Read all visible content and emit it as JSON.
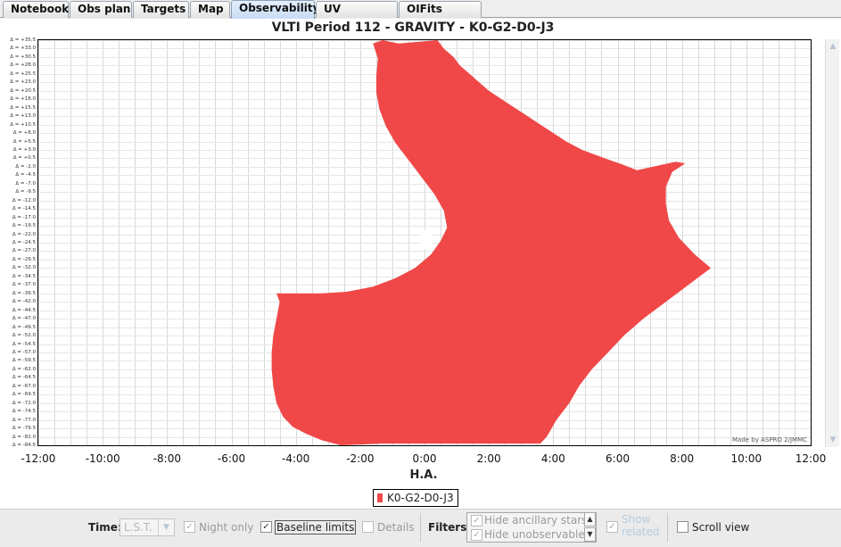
{
  "tabs": [
    {
      "label": "Notebook",
      "active": false
    },
    {
      "label": "Obs plan",
      "active": false
    },
    {
      "label": "Targets",
      "active": false
    },
    {
      "label": "Map",
      "active": false
    },
    {
      "label": "Observability",
      "active": true
    },
    {
      "label": "UV coverage",
      "active": false
    },
    {
      "label": "OIFits viewer",
      "active": false
    }
  ],
  "chart_data": {
    "type": "area",
    "title": "VLTI Period 112 - GRAVITY - K0-G2-D0-J3",
    "xlabel": "H.A.",
    "ylabel": "",
    "x_ticks": [
      "-12:00",
      "-10:00",
      "-8:00",
      "-6:00",
      "-4:00",
      "-2:00",
      "0:00",
      "2:00",
      "4:00",
      "6:00",
      "8:00",
      "10:00",
      "12:00"
    ],
    "xlim": [
      -12,
      12
    ],
    "y_ticks": [
      "Δ = +35.5",
      "Δ = +33.0",
      "Δ = +30.5",
      "Δ = +28.0",
      "Δ = +25.5",
      "Δ = +23.0",
      "Δ = +20.5",
      "Δ = +18.0",
      "Δ = +15.5",
      "Δ = +13.0",
      "Δ = +10.5",
      "Δ = +8.0",
      "Δ = +5.5",
      "Δ = +3.0",
      "Δ = +0.5",
      "Δ = -2.0",
      "Δ = -4.5",
      "Δ = -7.0",
      "Δ = -9.5",
      "Δ = -12.0",
      "Δ = -14.5",
      "Δ = -17.0",
      "Δ = -19.5",
      "Δ = -22.0",
      "Δ = -24.5",
      "Δ = -27.0",
      "Δ = -29.5",
      "Δ = -32.0",
      "Δ = -34.5",
      "Δ = -37.0",
      "Δ = -39.5",
      "Δ = -42.0",
      "Δ = -44.5",
      "Δ = -47.0",
      "Δ = -49.5",
      "Δ = -52.0",
      "Δ = -54.5",
      "Δ = -57.0",
      "Δ = -59.5",
      "Δ = -62.0",
      "Δ = -64.5",
      "Δ = -67.0",
      "Δ = -69.5",
      "Δ = -72.0",
      "Δ = -74.5",
      "Δ = -77.0",
      "Δ = -79.5",
      "Δ = -82.0",
      "Δ = -84.5"
    ],
    "ylim": [
      -84.5,
      35.5
    ],
    "series": [
      {
        "name": "K0-G2-D0-J3",
        "color": "#f04848",
        "region": [
          [
            -1.3,
            35.5
          ],
          [
            -0.8,
            34.5
          ],
          [
            0.4,
            35.5
          ],
          [
            0.6,
            33.0
          ],
          [
            0.9,
            30.5
          ],
          [
            1.1,
            28.0
          ],
          [
            1.4,
            25.5
          ],
          [
            1.7,
            23.0
          ],
          [
            2.0,
            20.5
          ],
          [
            2.4,
            18.0
          ],
          [
            2.8,
            15.5
          ],
          [
            3.2,
            13.0
          ],
          [
            3.6,
            10.5
          ],
          [
            4.0,
            8.0
          ],
          [
            4.4,
            5.5
          ],
          [
            4.9,
            3.0
          ],
          [
            5.6,
            0.5
          ],
          [
            6.2,
            -1.5
          ],
          [
            6.6,
            -3.0
          ],
          [
            7.8,
            -0.5
          ],
          [
            8.1,
            -1.0
          ],
          [
            7.7,
            -3.5
          ],
          [
            7.5,
            -8.0
          ],
          [
            7.5,
            -13.0
          ],
          [
            7.6,
            -18.0
          ],
          [
            7.9,
            -23.0
          ],
          [
            8.4,
            -28.0
          ],
          [
            8.9,
            -32.0
          ],
          [
            8.2,
            -37.0
          ],
          [
            7.5,
            -42.0
          ],
          [
            6.8,
            -47.0
          ],
          [
            6.2,
            -52.0
          ],
          [
            5.7,
            -57.0
          ],
          [
            5.2,
            -62.0
          ],
          [
            4.8,
            -67.0
          ],
          [
            4.5,
            -72.0
          ],
          [
            4.1,
            -77.0
          ],
          [
            3.8,
            -82.0
          ],
          [
            3.6,
            -84.0
          ],
          [
            -1.3,
            -84.0
          ],
          [
            -2.6,
            -84.5
          ],
          [
            -3.2,
            -83.0
          ],
          [
            -3.7,
            -81.0
          ],
          [
            -4.1,
            -79.0
          ],
          [
            -4.4,
            -76.0
          ],
          [
            -4.6,
            -72.0
          ],
          [
            -4.7,
            -67.0
          ],
          [
            -4.75,
            -62.0
          ],
          [
            -4.75,
            -57.0
          ],
          [
            -4.7,
            -52.0
          ],
          [
            -4.6,
            -47.0
          ],
          [
            -4.5,
            -42.0
          ],
          [
            -4.6,
            -39.5
          ],
          [
            -3.2,
            -39.5
          ],
          [
            -2.4,
            -39.0
          ],
          [
            -1.6,
            -37.5
          ],
          [
            -0.9,
            -35.0
          ],
          [
            -0.3,
            -32.0
          ],
          [
            0.2,
            -28.0
          ],
          [
            0.5,
            -24.0
          ],
          [
            0.7,
            -20.0
          ],
          [
            0.6,
            -15.0
          ],
          [
            0.3,
            -10.0
          ],
          [
            -0.1,
            -5.0
          ],
          [
            -0.5,
            0.0
          ],
          [
            -0.9,
            5.0
          ],
          [
            -1.2,
            10.0
          ],
          [
            -1.4,
            15.0
          ],
          [
            -1.5,
            20.0
          ],
          [
            -1.5,
            25.0
          ],
          [
            -1.45,
            30.0
          ],
          [
            -1.6,
            34.5
          ]
        ],
        "hole": {
          "x": 0.05,
          "y": -23.5
        }
      }
    ],
    "legend_position": "bottom-center",
    "grid": true,
    "credit": "Made by ASPRO 2/JMMC"
  },
  "legend": {
    "label": "K0-G2-D0-J3",
    "color": "#f04848"
  },
  "toolbar": {
    "time_label": "Time:",
    "time_value": "L.S.T.",
    "night_only_label": "Night only",
    "baseline_limits_label": "Baseline limits",
    "details_label": "Details",
    "filters_label": "Filters:",
    "hide_ancillary_label": "Hide ancillary stars",
    "hide_unobservable_label": "Hide unobservable",
    "show_related_line1": "Show",
    "show_related_line2": "related",
    "scroll_view_label": "Scroll view",
    "check_mark": "✓"
  }
}
